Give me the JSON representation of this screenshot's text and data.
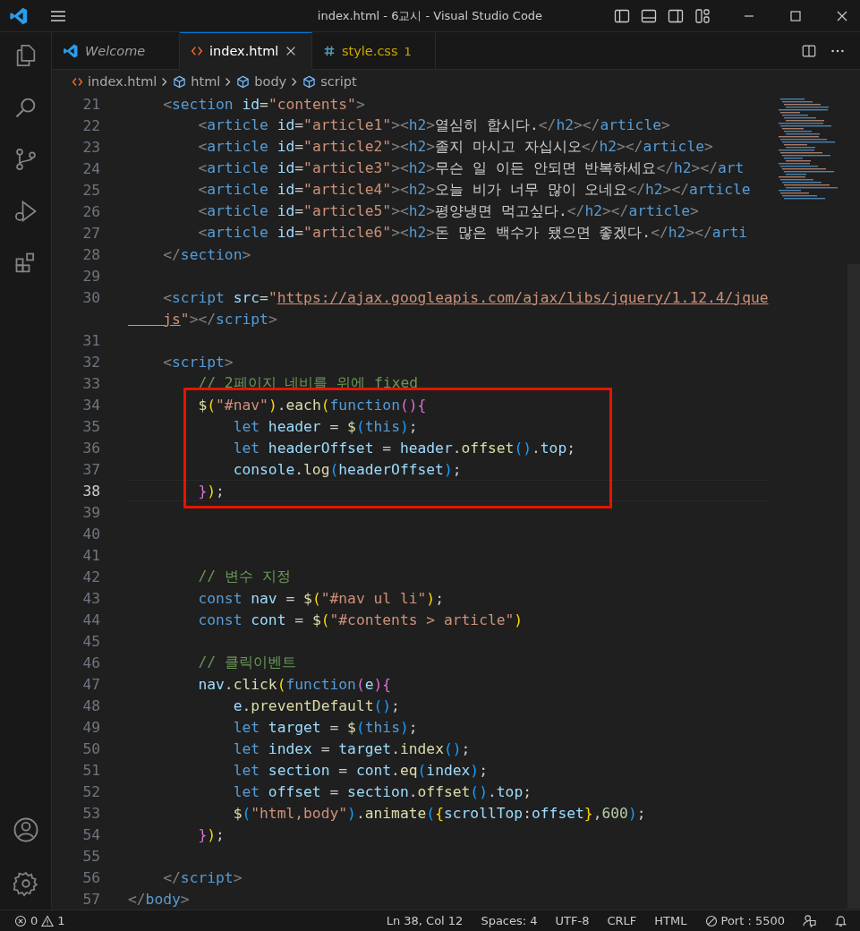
{
  "window": {
    "title": "index.html - 6교시 - Visual Studio Code"
  },
  "tabs": [
    {
      "label": "Welcome",
      "kind": "welcome",
      "selected": false
    },
    {
      "label": "index.html",
      "kind": "html",
      "selected": true
    },
    {
      "label": "style.css",
      "kind": "css",
      "selected": false,
      "problems": "1"
    }
  ],
  "breadcrumb": [
    {
      "label": "index.html",
      "kind": "file"
    },
    {
      "label": "html",
      "kind": "element"
    },
    {
      "label": "body",
      "kind": "element"
    },
    {
      "label": "script",
      "kind": "element"
    }
  ],
  "editor": {
    "lines": [
      {
        "number": "21",
        "current": false,
        "tokens": [
          {
            "text": "    <",
            "kind": "punct"
          },
          {
            "text": "section",
            "kind": "tag"
          },
          {
            "text": " id",
            "kind": "attr"
          },
          {
            "text": "=",
            "kind": "text"
          },
          {
            "text": "\"contents\"",
            "kind": "string"
          },
          {
            "text": ">",
            "kind": "punct"
          }
        ]
      },
      {
        "number": "22",
        "current": false,
        "tokens": [
          {
            "text": "        <",
            "kind": "punct"
          },
          {
            "text": "article",
            "kind": "tag"
          },
          {
            "text": " id",
            "kind": "attr"
          },
          {
            "text": "=",
            "kind": "text"
          },
          {
            "text": "\"article1\"",
            "kind": "string"
          },
          {
            "text": "><",
            "kind": "punct"
          },
          {
            "text": "h2",
            "kind": "tag"
          },
          {
            "text": ">",
            "kind": "punct"
          },
          {
            "text": "열심히 합시다.",
            "kind": "text"
          },
          {
            "text": "</",
            "kind": "punct"
          },
          {
            "text": "h2",
            "kind": "tag"
          },
          {
            "text": "></",
            "kind": "punct"
          },
          {
            "text": "article",
            "kind": "tag"
          },
          {
            "text": ">",
            "kind": "punct"
          }
        ]
      },
      {
        "number": "23",
        "current": false,
        "tokens": [
          {
            "text": "        <",
            "kind": "punct"
          },
          {
            "text": "article",
            "kind": "tag"
          },
          {
            "text": " id",
            "kind": "attr"
          },
          {
            "text": "=",
            "kind": "text"
          },
          {
            "text": "\"article2\"",
            "kind": "string"
          },
          {
            "text": "><",
            "kind": "punct"
          },
          {
            "text": "h2",
            "kind": "tag"
          },
          {
            "text": ">",
            "kind": "punct"
          },
          {
            "text": "졸지 마시고 자십시오",
            "kind": "text"
          },
          {
            "text": "</",
            "kind": "punct"
          },
          {
            "text": "h2",
            "kind": "tag"
          },
          {
            "text": "></",
            "kind": "punct"
          },
          {
            "text": "article",
            "kind": "tag"
          },
          {
            "text": ">",
            "kind": "punct"
          }
        ]
      },
      {
        "number": "24",
        "current": false,
        "tokens": [
          {
            "text": "        <",
            "kind": "punct"
          },
          {
            "text": "article",
            "kind": "tag"
          },
          {
            "text": " id",
            "kind": "attr"
          },
          {
            "text": "=",
            "kind": "text"
          },
          {
            "text": "\"article3\"",
            "kind": "string"
          },
          {
            "text": "><",
            "kind": "punct"
          },
          {
            "text": "h2",
            "kind": "tag"
          },
          {
            "text": ">",
            "kind": "punct"
          },
          {
            "text": "무슨 일 이든 안되면 반복하세요",
            "kind": "text"
          },
          {
            "text": "</",
            "kind": "punct"
          },
          {
            "text": "h2",
            "kind": "tag"
          },
          {
            "text": "></",
            "kind": "punct"
          },
          {
            "text": "art",
            "kind": "tag"
          }
        ]
      },
      {
        "number": "25",
        "current": false,
        "tokens": [
          {
            "text": "        <",
            "kind": "punct"
          },
          {
            "text": "article",
            "kind": "tag"
          },
          {
            "text": " id",
            "kind": "attr"
          },
          {
            "text": "=",
            "kind": "text"
          },
          {
            "text": "\"article4\"",
            "kind": "string"
          },
          {
            "text": "><",
            "kind": "punct"
          },
          {
            "text": "h2",
            "kind": "tag"
          },
          {
            "text": ">",
            "kind": "punct"
          },
          {
            "text": "오늘 비가 너무 많이 오네요",
            "kind": "text"
          },
          {
            "text": "</",
            "kind": "punct"
          },
          {
            "text": "h2",
            "kind": "tag"
          },
          {
            "text": "></",
            "kind": "punct"
          },
          {
            "text": "article",
            "kind": "tag"
          }
        ]
      },
      {
        "number": "26",
        "current": false,
        "tokens": [
          {
            "text": "        <",
            "kind": "punct"
          },
          {
            "text": "article",
            "kind": "tag"
          },
          {
            "text": " id",
            "kind": "attr"
          },
          {
            "text": "=",
            "kind": "text"
          },
          {
            "text": "\"article5\"",
            "kind": "string"
          },
          {
            "text": "><",
            "kind": "punct"
          },
          {
            "text": "h2",
            "kind": "tag"
          },
          {
            "text": ">",
            "kind": "punct"
          },
          {
            "text": "평양냉면 먹고싶다.",
            "kind": "text"
          },
          {
            "text": "</",
            "kind": "punct"
          },
          {
            "text": "h2",
            "kind": "tag"
          },
          {
            "text": "></",
            "kind": "punct"
          },
          {
            "text": "article",
            "kind": "tag"
          },
          {
            "text": ">",
            "kind": "punct"
          }
        ]
      },
      {
        "number": "27",
        "current": false,
        "tokens": [
          {
            "text": "        <",
            "kind": "punct"
          },
          {
            "text": "article",
            "kind": "tag"
          },
          {
            "text": " id",
            "kind": "attr"
          },
          {
            "text": "=",
            "kind": "text"
          },
          {
            "text": "\"article6\"",
            "kind": "string"
          },
          {
            "text": "><",
            "kind": "punct"
          },
          {
            "text": "h2",
            "kind": "tag"
          },
          {
            "text": ">",
            "kind": "punct"
          },
          {
            "text": "돈 많은 백수가 됐으면 좋겠다.",
            "kind": "text"
          },
          {
            "text": "</",
            "kind": "punct"
          },
          {
            "text": "h2",
            "kind": "tag"
          },
          {
            "text": "></",
            "kind": "punct"
          },
          {
            "text": "arti",
            "kind": "tag"
          }
        ]
      },
      {
        "number": "28",
        "current": false,
        "tokens": [
          {
            "text": "    </",
            "kind": "punct"
          },
          {
            "text": "section",
            "kind": "tag"
          },
          {
            "text": ">",
            "kind": "punct"
          }
        ]
      },
      {
        "number": "29",
        "current": false
      },
      {
        "number": "30",
        "current": false,
        "tokens": [
          {
            "text": "    <",
            "kind": "punct"
          },
          {
            "text": "script",
            "kind": "tag"
          },
          {
            "text": " src",
            "kind": "attr"
          },
          {
            "text": "=",
            "kind": "text"
          },
          {
            "text": "\"",
            "kind": "string"
          },
          {
            "text": "https://ajax.googleapis.com/ajax/libs/jquery/1.12.4/jque",
            "kind": "link"
          }
        ]
      },
      {
        "tokens": [
          {
            "text": "    js",
            "kind": "link"
          },
          {
            "text": "\"",
            "kind": "string"
          },
          {
            "text": "></",
            "kind": "punct"
          },
          {
            "text": "script",
            "kind": "tag"
          },
          {
            "text": ">",
            "kind": "punct"
          }
        ]
      },
      {
        "number": "31",
        "current": false
      },
      {
        "number": "32",
        "current": false,
        "tokens": [
          {
            "text": "    <",
            "kind": "punct"
          },
          {
            "text": "script",
            "kind": "tag"
          },
          {
            "text": ">",
            "kind": "punct"
          }
        ]
      },
      {
        "number": "33",
        "current": false,
        "tokens": [
          {
            "text": "        // 2페이지 네비를 위에 fixed",
            "kind": "comment"
          }
        ]
      },
      {
        "number": "34",
        "current": false,
        "tokens": [
          {
            "text": "        $",
            "kind": "function"
          },
          {
            "text": "(",
            "kind": "bracket1"
          },
          {
            "text": "\"#nav\"",
            "kind": "string"
          },
          {
            "text": ")",
            "kind": "bracket1"
          },
          {
            "text": ".",
            "kind": "text"
          },
          {
            "text": "each",
            "kind": "function"
          },
          {
            "text": "(",
            "kind": "bracket1"
          },
          {
            "text": "function",
            "kind": "keyword"
          },
          {
            "text": "(){",
            "kind": "bracket2"
          }
        ]
      },
      {
        "number": "35",
        "current": false,
        "tokens": [
          {
            "text": "            let",
            "kind": "keyword"
          },
          {
            "text": " header",
            "kind": "variable"
          },
          {
            "text": " = ",
            "kind": "text"
          },
          {
            "text": "$",
            "kind": "function"
          },
          {
            "text": "(",
            "kind": "bracket3"
          },
          {
            "text": "this",
            "kind": "keyword"
          },
          {
            "text": ")",
            "kind": "bracket3"
          },
          {
            "text": ";",
            "kind": "text"
          }
        ]
      },
      {
        "number": "36",
        "current": false,
        "tokens": [
          {
            "text": "            let",
            "kind": "keyword"
          },
          {
            "text": " headerOffset",
            "kind": "variable"
          },
          {
            "text": " = ",
            "kind": "text"
          },
          {
            "text": "header",
            "kind": "variable"
          },
          {
            "text": ".",
            "kind": "text"
          },
          {
            "text": "offset",
            "kind": "function"
          },
          {
            "text": "()",
            "kind": "bracket3"
          },
          {
            "text": ".",
            "kind": "text"
          },
          {
            "text": "top",
            "kind": "variable"
          },
          {
            "text": ";",
            "kind": "text"
          }
        ]
      },
      {
        "number": "37",
        "current": false,
        "tokens": [
          {
            "text": "            console",
            "kind": "variable"
          },
          {
            "text": ".",
            "kind": "text"
          },
          {
            "text": "log",
            "kind": "function"
          },
          {
            "text": "(",
            "kind": "bracket3"
          },
          {
            "text": "headerOffset",
            "kind": "variable"
          },
          {
            "text": ")",
            "kind": "bracket3"
          },
          {
            "text": ";",
            "kind": "text"
          }
        ]
      },
      {
        "number": "38",
        "current": true,
        "tokens": [
          {
            "text": "        }",
            "kind": "bracket2"
          },
          {
            "text": ")",
            "kind": "bracket1"
          },
          {
            "text": ";",
            "kind": "text"
          }
        ]
      },
      {
        "number": "39",
        "current": false
      },
      {
        "number": "40",
        "current": false
      },
      {
        "number": "41",
        "current": false
      },
      {
        "number": "42",
        "current": false,
        "tokens": [
          {
            "text": "        // 변수 지정",
            "kind": "comment"
          }
        ]
      },
      {
        "number": "43",
        "current": false,
        "tokens": [
          {
            "text": "        const",
            "kind": "keyword"
          },
          {
            "text": " nav",
            "kind": "variable"
          },
          {
            "text": " = ",
            "kind": "text"
          },
          {
            "text": "$",
            "kind": "function"
          },
          {
            "text": "(",
            "kind": "bracket1"
          },
          {
            "text": "\"#nav ul li\"",
            "kind": "string"
          },
          {
            "text": ")",
            "kind": "bracket1"
          },
          {
            "text": ";",
            "kind": "text"
          }
        ]
      },
      {
        "number": "44",
        "current": false,
        "tokens": [
          {
            "text": "        const",
            "kind": "keyword"
          },
          {
            "text": " cont",
            "kind": "variable"
          },
          {
            "text": " = ",
            "kind": "text"
          },
          {
            "text": "$",
            "kind": "function"
          },
          {
            "text": "(",
            "kind": "bracket1"
          },
          {
            "text": "\"#contents > article\"",
            "kind": "string"
          },
          {
            "text": ")",
            "kind": "bracket1"
          }
        ]
      },
      {
        "number": "45",
        "current": false
      },
      {
        "number": "46",
        "current": false,
        "tokens": [
          {
            "text": "        // 클릭이벤트",
            "kind": "comment"
          }
        ]
      },
      {
        "number": "47",
        "current": false,
        "tokens": [
          {
            "text": "        nav",
            "kind": "variable"
          },
          {
            "text": ".",
            "kind": "text"
          },
          {
            "text": "click",
            "kind": "function"
          },
          {
            "text": "(",
            "kind": "bracket1"
          },
          {
            "text": "function",
            "kind": "keyword"
          },
          {
            "text": "(",
            "kind": "bracket2"
          },
          {
            "text": "e",
            "kind": "variable"
          },
          {
            "text": "){",
            "kind": "bracket2"
          }
        ]
      },
      {
        "number": "48",
        "current": false,
        "tokens": [
          {
            "text": "            e",
            "kind": "variable"
          },
          {
            "text": ".",
            "kind": "text"
          },
          {
            "text": "preventDefault",
            "kind": "function"
          },
          {
            "text": "()",
            "kind": "bracket3"
          },
          {
            "text": ";",
            "kind": "text"
          }
        ]
      },
      {
        "number": "49",
        "current": false,
        "tokens": [
          {
            "text": "            let",
            "kind": "keyword"
          },
          {
            "text": " target",
            "kind": "variable"
          },
          {
            "text": " = ",
            "kind": "text"
          },
          {
            "text": "$",
            "kind": "function"
          },
          {
            "text": "(",
            "kind": "bracket3"
          },
          {
            "text": "this",
            "kind": "keyword"
          },
          {
            "text": ")",
            "kind": "bracket3"
          },
          {
            "text": ";",
            "kind": "text"
          }
        ]
      },
      {
        "number": "50",
        "current": false,
        "tokens": [
          {
            "text": "            let",
            "kind": "keyword"
          },
          {
            "text": " index",
            "kind": "variable"
          },
          {
            "text": " = ",
            "kind": "text"
          },
          {
            "text": "target",
            "kind": "variable"
          },
          {
            "text": ".",
            "kind": "text"
          },
          {
            "text": "index",
            "kind": "function"
          },
          {
            "text": "()",
            "kind": "bracket3"
          },
          {
            "text": ";",
            "kind": "text"
          }
        ]
      },
      {
        "number": "51",
        "current": false,
        "tokens": [
          {
            "text": "            let",
            "kind": "keyword"
          },
          {
            "text": " section",
            "kind": "variable"
          },
          {
            "text": " = ",
            "kind": "text"
          },
          {
            "text": "cont",
            "kind": "variable"
          },
          {
            "text": ".",
            "kind": "text"
          },
          {
            "text": "eq",
            "kind": "function"
          },
          {
            "text": "(",
            "kind": "bracket3"
          },
          {
            "text": "index",
            "kind": "variable"
          },
          {
            "text": ")",
            "kind": "bracket3"
          },
          {
            "text": ";",
            "kind": "text"
          }
        ]
      },
      {
        "number": "52",
        "current": false,
        "tokens": [
          {
            "text": "            let",
            "kind": "keyword"
          },
          {
            "text": " offset",
            "kind": "variable"
          },
          {
            "text": " = ",
            "kind": "text"
          },
          {
            "text": "section",
            "kind": "variable"
          },
          {
            "text": ".",
            "kind": "text"
          },
          {
            "text": "offset",
            "kind": "function"
          },
          {
            "text": "()",
            "kind": "bracket3"
          },
          {
            "text": ".",
            "kind": "text"
          },
          {
            "text": "top",
            "kind": "variable"
          },
          {
            "text": ";",
            "kind": "text"
          }
        ]
      },
      {
        "number": "53",
        "current": false,
        "tokens": [
          {
            "text": "            $",
            "kind": "function"
          },
          {
            "text": "(",
            "kind": "bracket3"
          },
          {
            "text": "\"html,body\"",
            "kind": "string"
          },
          {
            "text": ")",
            "kind": "bracket3"
          },
          {
            "text": ".",
            "kind": "text"
          },
          {
            "text": "animate",
            "kind": "function"
          },
          {
            "text": "(",
            "kind": "bracket3"
          },
          {
            "text": "{",
            "kind": "bracket1"
          },
          {
            "text": "scrollTop",
            "kind": "variable"
          },
          {
            "text": ":",
            "kind": "text"
          },
          {
            "text": "offset",
            "kind": "variable"
          },
          {
            "text": "}",
            "kind": "bracket1"
          },
          {
            "text": ",",
            "kind": "text"
          },
          {
            "text": "600",
            "kind": "number"
          },
          {
            "text": ")",
            "kind": "bracket3"
          },
          {
            "text": ";",
            "kind": "text"
          }
        ]
      },
      {
        "number": "54",
        "current": false,
        "tokens": [
          {
            "text": "        }",
            "kind": "bracket2"
          },
          {
            "text": ")",
            "kind": "bracket1"
          },
          {
            "text": ";",
            "kind": "text"
          }
        ]
      },
      {
        "number": "55",
        "current": false
      },
      {
        "number": "56",
        "current": false,
        "tokens": [
          {
            "text": "    </",
            "kind": "punct"
          },
          {
            "text": "script",
            "kind": "tag"
          },
          {
            "text": ">",
            "kind": "punct"
          }
        ]
      },
      {
        "number": "57",
        "current": false,
        "tokens": [
          {
            "text": "</",
            "kind": "punct"
          },
          {
            "text": "body",
            "kind": "tag"
          },
          {
            "text": ">",
            "kind": "punct"
          }
        ]
      }
    ]
  },
  "status_bar": {
    "errors": "0",
    "warnings": "1",
    "position": "Ln 38, Col 12",
    "indent": "Spaces: 4",
    "encoding": "UTF-8",
    "eol": "CRLF",
    "language": "HTML",
    "port": "Port : 5500"
  }
}
